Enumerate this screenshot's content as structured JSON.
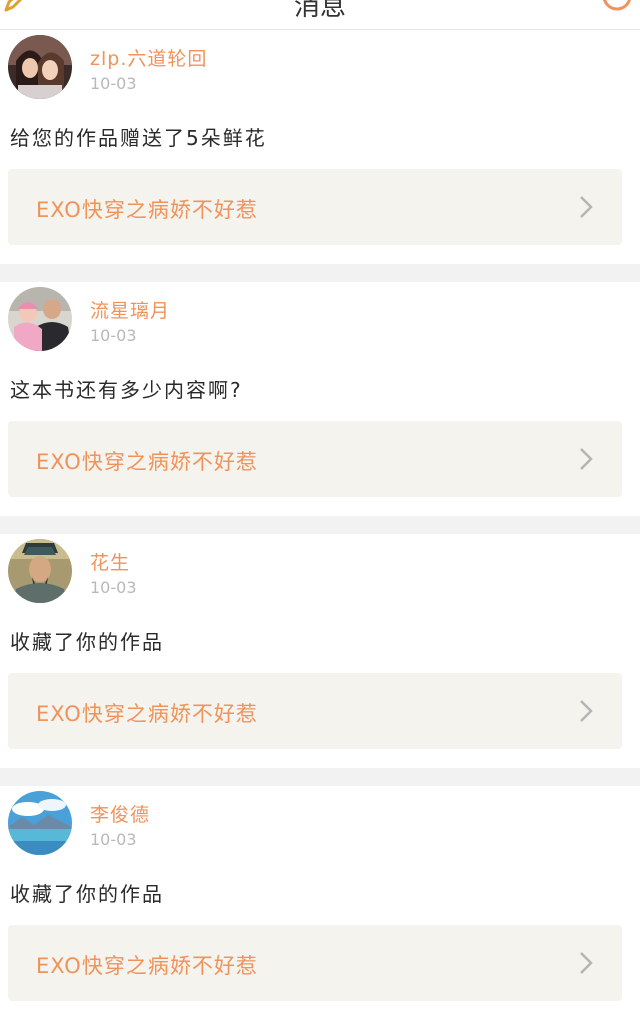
{
  "header": {
    "title": "消息",
    "back_icon": "pencil-icon",
    "action_icon": "orange-circle-icon"
  },
  "colors": {
    "accent": "#f0935a",
    "date": "#b9b9b9",
    "card_bg": "#f4f3ee",
    "divider": "#f2f2f2"
  },
  "feed": {
    "items": [
      {
        "username": "zlp.六道轮回",
        "date": "10-03",
        "message": "给您的作品赠送了5朵鲜花",
        "book_title": "EXO快穿之病娇不好惹",
        "avatar": "two-women-photo"
      },
      {
        "username": "流星璃月",
        "date": "10-03",
        "message": "这本书还有多少内容啊?",
        "book_title": "EXO快穿之病娇不好惹",
        "avatar": "man-with-baby-photo"
      },
      {
        "username": "花生",
        "date": "10-03",
        "message": "收藏了你的作品",
        "book_title": "EXO快穿之病娇不好惹",
        "avatar": "ancient-warrior-portrait"
      },
      {
        "username": "李俊德",
        "date": "10-03",
        "message": "收藏了你的作品",
        "book_title": "EXO快穿之病娇不好惹",
        "avatar": "mountain-lake-landscape"
      }
    ]
  }
}
